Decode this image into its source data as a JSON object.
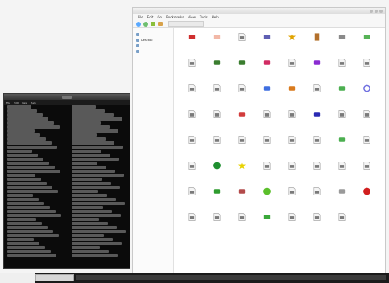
{
  "terminal": {
    "title": "",
    "menu": [
      "File",
      "Edit",
      "View",
      "Help"
    ]
  },
  "filemanager": {
    "title": "",
    "menu": [
      "File",
      "Edit",
      "Go",
      "Bookmarks",
      "View",
      "Tools",
      "Help"
    ],
    "path": "",
    "sidebar": {
      "header": "",
      "items": [
        "",
        "Desktop",
        "",
        ""
      ]
    },
    "files": [
      {
        "label": "",
        "color": "#cf2f2f",
        "kind": "shape"
      },
      {
        "label": "",
        "color": "#f2b8a7",
        "kind": "shape"
      },
      {
        "label": "",
        "color": "#bfbfbf",
        "kind": "doc"
      },
      {
        "label": "",
        "color": "#5f5fb3",
        "kind": "shape"
      },
      {
        "label": "",
        "color": "#e0a300",
        "kind": "star"
      },
      {
        "label": "",
        "color": "#b3702b",
        "kind": "door"
      },
      {
        "label": "",
        "color": "#8a8a8a",
        "kind": "shape"
      },
      {
        "label": "",
        "color": "#57b357",
        "kind": "shape"
      },
      {
        "label": "",
        "color": "#4c9d3a",
        "kind": "shape"
      },
      {
        "label": "",
        "color": "#bfbfbf",
        "kind": "doc"
      },
      {
        "label": "",
        "color": "#3a7d2f",
        "kind": "shape"
      },
      {
        "label": "",
        "color": "#3a7d2f",
        "kind": "shape"
      },
      {
        "label": "",
        "color": "#d12b63",
        "kind": "shape"
      },
      {
        "label": "",
        "color": "#bfbfbf",
        "kind": "doc"
      },
      {
        "label": "",
        "color": "#8a2bd1",
        "kind": "shape"
      },
      {
        "label": "",
        "color": "#bfbfbf",
        "kind": "doc"
      },
      {
        "label": "",
        "color": "#bfbfbf",
        "kind": "doc"
      },
      {
        "label": "",
        "color": "#bfbfbf",
        "kind": "doc"
      },
      {
        "label": "",
        "color": "#bfbfbf",
        "kind": "doc"
      },
      {
        "label": "",
        "color": "#bfbfbf",
        "kind": "doc"
      },
      {
        "label": "",
        "color": "#bfbfbf",
        "kind": "doc"
      },
      {
        "label": "",
        "color": "#3f6fe0",
        "kind": "shape"
      },
      {
        "label": "",
        "color": "#d97a1d",
        "kind": "shape"
      },
      {
        "label": "",
        "color": "#bfbfbf",
        "kind": "doc"
      },
      {
        "label": "",
        "color": "#4caf50",
        "kind": "shape"
      },
      {
        "label": "",
        "color": "#6f6fe0",
        "kind": "ring"
      },
      {
        "label": "",
        "color": "#bfbfbf",
        "kind": "doc"
      },
      {
        "label": "",
        "color": "#bfbfbf",
        "kind": "doc"
      },
      {
        "label": "",
        "color": "#bfbfbf",
        "kind": "doc"
      },
      {
        "label": "",
        "color": "#d23c3c",
        "kind": "shape"
      },
      {
        "label": "",
        "color": "#bfbfbf",
        "kind": "doc"
      },
      {
        "label": "",
        "color": "#bfbfbf",
        "kind": "doc"
      },
      {
        "label": "",
        "color": "#2a2ab3",
        "kind": "shape"
      },
      {
        "label": "",
        "color": "#bfbfbf",
        "kind": "doc"
      },
      {
        "label": "",
        "color": "#bfbfbf",
        "kind": "doc"
      },
      {
        "label": "",
        "color": "#7acb3c",
        "kind": "shape"
      },
      {
        "label": "",
        "color": "#bfbfbf",
        "kind": "doc"
      },
      {
        "label": "",
        "color": "#bfbfbf",
        "kind": "doc"
      },
      {
        "label": "",
        "color": "#bfbfbf",
        "kind": "doc"
      },
      {
        "label": "",
        "color": "#bfbfbf",
        "kind": "doc"
      },
      {
        "label": "",
        "color": "#bfbfbf",
        "kind": "doc"
      },
      {
        "label": "",
        "color": "#bfbfbf",
        "kind": "doc"
      },
      {
        "label": "",
        "color": "#4caf50",
        "kind": "shape"
      },
      {
        "label": "",
        "color": "#bfbfbf",
        "kind": "doc"
      },
      {
        "label": "",
        "color": "#bfbfbf",
        "kind": "doc"
      },
      {
        "label": "",
        "color": "#bfbfbf",
        "kind": "doc"
      },
      {
        "label": "",
        "color": "#1f8f2f",
        "kind": "ball"
      },
      {
        "label": "",
        "color": "#e8d200",
        "kind": "star"
      },
      {
        "label": "",
        "color": "#bfbfbf",
        "kind": "doc"
      },
      {
        "label": "",
        "color": "#bfbfbf",
        "kind": "doc"
      },
      {
        "label": "",
        "color": "#bfbfbf",
        "kind": "doc"
      },
      {
        "label": "",
        "color": "#bfbfbf",
        "kind": "doc"
      },
      {
        "label": "",
        "color": "#bfbfbf",
        "kind": "doc"
      },
      {
        "label": "",
        "color": "#d32f2f",
        "kind": "shape"
      },
      {
        "label": "",
        "color": "#bfbfbf",
        "kind": "doc"
      },
      {
        "label": "",
        "color": "#2e9c2e",
        "kind": "shape"
      },
      {
        "label": "",
        "color": "#b34b4b",
        "kind": "shape"
      },
      {
        "label": "",
        "color": "#5bbf2b",
        "kind": "ball"
      },
      {
        "label": "",
        "color": "#bfbfbf",
        "kind": "doc"
      },
      {
        "label": "",
        "color": "#bfbfbf",
        "kind": "doc"
      },
      {
        "label": "",
        "color": "#9a9a9a",
        "kind": "shape"
      },
      {
        "label": "",
        "color": "#d11f1f",
        "kind": "ball"
      },
      {
        "label": "",
        "color": "#bfbfbf",
        "kind": "doc"
      },
      {
        "label": "",
        "color": "#bfbfbf",
        "kind": "doc"
      },
      {
        "label": "",
        "color": "#bfbfbf",
        "kind": "doc"
      },
      {
        "label": "",
        "color": "#bfbfbf",
        "kind": "doc"
      },
      {
        "label": "",
        "color": "#3aa83a",
        "kind": "shape"
      },
      {
        "label": "",
        "color": "#bfbfbf",
        "kind": "doc"
      },
      {
        "label": "",
        "color": "#bfbfbf",
        "kind": "doc"
      },
      {
        "label": "",
        "color": "#bfbfbf",
        "kind": "doc"
      }
    ]
  },
  "taskbar": {
    "items": [
      ""
    ]
  }
}
